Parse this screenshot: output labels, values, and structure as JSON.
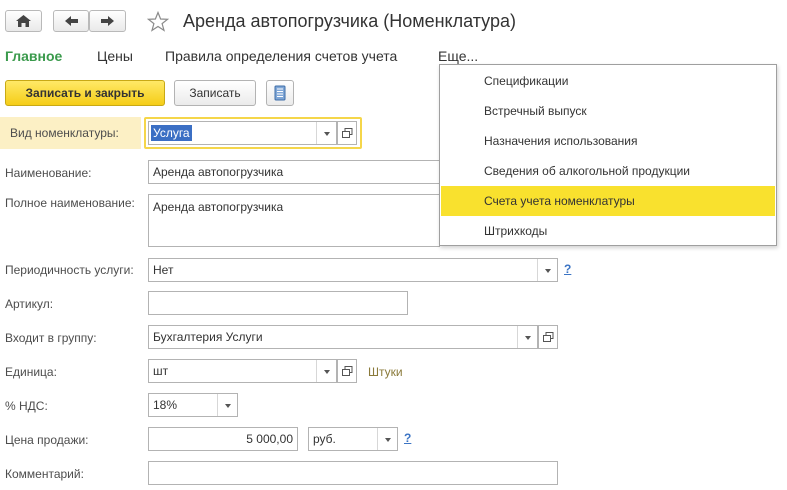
{
  "window": {
    "title": "Аренда автопогрузчика (Номенклатура)"
  },
  "tabs": [
    {
      "label": "Главное"
    },
    {
      "label": "Цены"
    },
    {
      "label": "Правила определения счетов учета"
    },
    {
      "label": "Еще..."
    }
  ],
  "toolbar": {
    "save_close_label": "Записать и закрыть",
    "save_label": "Записать"
  },
  "form": {
    "kind_label": "Вид номенклатуры:",
    "kind_value": "Услуга",
    "name_label": "Наименование:",
    "name_value": "Аренда автопогрузчика",
    "full_name_label": "Полное наименование:",
    "full_name_value": "Аренда автопогрузчика",
    "periodicity_label": "Периодичность услуги:",
    "periodicity_value": "Нет",
    "article_label": "Артикул:",
    "article_value": "",
    "group_label": "Входит в группу:",
    "group_value": "Бухгалтерия Услуги",
    "unit_label": "Единица:",
    "unit_value": "шт",
    "unit_desc": "Штуки",
    "vat_label": "% НДС:",
    "vat_value": "18%",
    "price_label": "Цена продажи:",
    "price_value": "5 000,00",
    "currency_value": "руб.",
    "comment_label": "Комментарий:",
    "comment_value": "",
    "help_mark": "?"
  },
  "more_menu": {
    "items": [
      {
        "label": "Спецификации"
      },
      {
        "label": "Встречный выпуск"
      },
      {
        "label": "Назначения использования"
      },
      {
        "label": "Сведения об алкогольной продукции"
      },
      {
        "label": "Счета учета номенклатуры"
      },
      {
        "label": "Штрихкоды"
      }
    ],
    "highlighted_index": 4
  },
  "colors": {
    "accent_green": "#3a9a4c",
    "highlight_yellow": "#f9e12e",
    "primary_button": "#f5cd17",
    "link_blue": "#3b74c4"
  }
}
